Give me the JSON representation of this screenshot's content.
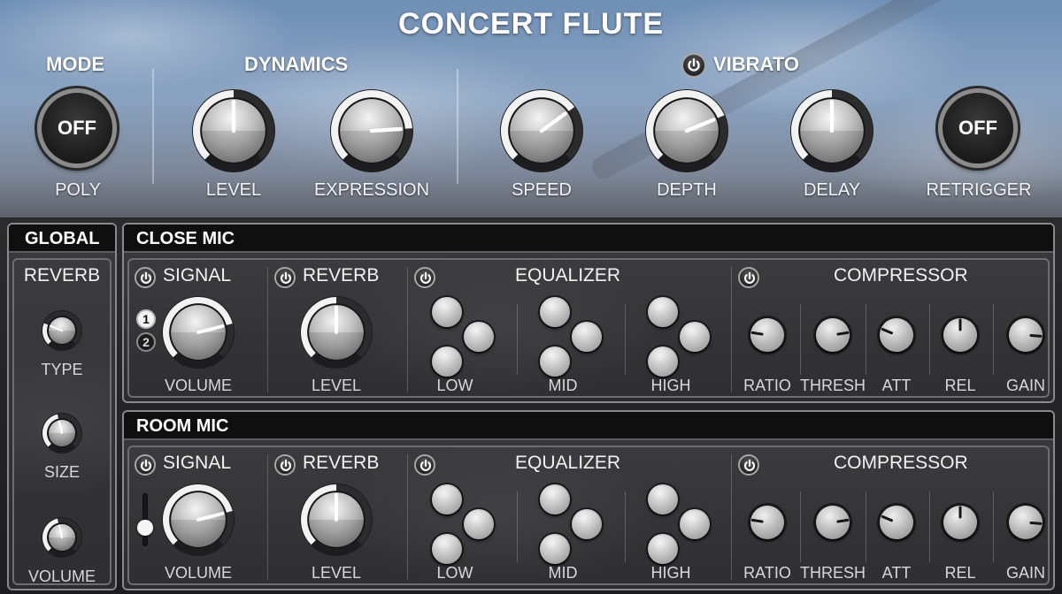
{
  "header": {
    "title": "CONCERT FLUTE",
    "mode": {
      "label": "MODE",
      "button": "OFF",
      "caption": "POLY"
    },
    "dynamics": {
      "label": "DYNAMICS",
      "level": {
        "caption": "LEVEL",
        "value": 0.5
      },
      "expression": {
        "caption": "EXPRESSION",
        "value": 0.82
      }
    },
    "vibrato": {
      "label": "VIBRATO",
      "power_icon": "power-icon",
      "speed": {
        "caption": "SPEED",
        "value": 0.7
      },
      "depth": {
        "caption": "DEPTH",
        "value": 0.75
      },
      "delay": {
        "caption": "DELAY",
        "value": 0.5
      }
    },
    "retrigger": {
      "button": "OFF",
      "caption": "RETRIGGER"
    }
  },
  "global": {
    "title": "GLOBAL",
    "reverb_label": "REVERB",
    "type": {
      "caption": "TYPE",
      "value": 0.25
    },
    "size": {
      "caption": "SIZE",
      "value": 0.45
    },
    "volume": {
      "caption": "VOLUME",
      "value": 0.45
    }
  },
  "close_mic": {
    "title": "CLOSE MIC",
    "signal": {
      "label": "SIGNAL",
      "volume_caption": "VOLUME",
      "volume": 0.78,
      "selector": [
        "1",
        "2"
      ]
    },
    "reverb": {
      "label": "REVERB",
      "level_caption": "LEVEL",
      "level": 0.5
    },
    "equalizer": {
      "label": "EQUALIZER",
      "bands": [
        "LOW",
        "MID",
        "HIGH"
      ]
    },
    "compressor": {
      "label": "COMPRESSOR",
      "knobs": [
        {
          "caption": "RATIO",
          "value": 0.2
        },
        {
          "caption": "THRESH",
          "value": 0.8
        },
        {
          "caption": "ATT",
          "value": 0.25
        },
        {
          "caption": "REL",
          "value": 0.5
        },
        {
          "caption": "GAIN",
          "value": 0.85
        }
      ]
    }
  },
  "room_mic": {
    "title": "ROOM MIC",
    "signal": {
      "label": "SIGNAL",
      "volume_caption": "VOLUME",
      "volume": 0.78,
      "slider": 0.35
    },
    "reverb": {
      "label": "REVERB",
      "level_caption": "LEVEL",
      "level": 0.5
    },
    "equalizer": {
      "label": "EQUALIZER",
      "bands": [
        "LOW",
        "MID",
        "HIGH"
      ]
    },
    "compressor": {
      "label": "COMPRESSOR",
      "knobs": [
        {
          "caption": "RATIO",
          "value": 0.2
        },
        {
          "caption": "THRESH",
          "value": 0.8
        },
        {
          "caption": "ATT",
          "value": 0.25
        },
        {
          "caption": "REL",
          "value": 0.5
        },
        {
          "caption": "GAIN",
          "value": 0.85
        }
      ]
    }
  },
  "colors": {
    "arc_fill": "#f2f2f2",
    "arc_track": "#2a2a2c",
    "panel_border": "#8a8a8a",
    "header_bar": "#0f0f10"
  }
}
